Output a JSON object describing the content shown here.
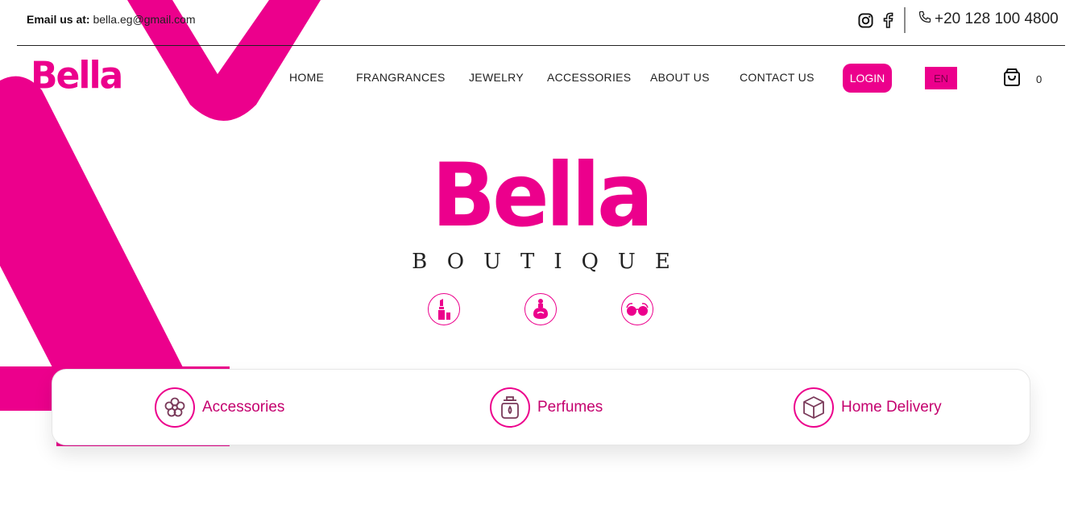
{
  "topbar": {
    "email_label": "Email us at:",
    "email_value": "bella.eg@gmail.com",
    "phone": "+20 128 100 4800",
    "social_icons": [
      "instagram-icon",
      "facebook-icon"
    ]
  },
  "nav": {
    "logo": "Bella",
    "items": [
      "HOME",
      "FRANGRANCES",
      "JEWELRY",
      "ACCESSORIES",
      "ABOUT US",
      "CONTACT US"
    ],
    "login": "LOGIN",
    "lang": "EN",
    "cart_count": "0"
  },
  "hero": {
    "logo": "Bella",
    "subtitle": "BOUTIQUE",
    "icons": [
      "lipstick-icon",
      "perfume-bottle-icon",
      "sunglasses-icon"
    ]
  },
  "features": [
    {
      "label": "Accessories",
      "icon": "flower-icon"
    },
    {
      "label": "Perfumes",
      "icon": "perfume-jar-icon"
    },
    {
      "label": "Home Delivery",
      "icon": "box-icon"
    }
  ],
  "colors": {
    "brand": "#ec008c",
    "text": "#222222",
    "feature_text": "#c4006e"
  }
}
